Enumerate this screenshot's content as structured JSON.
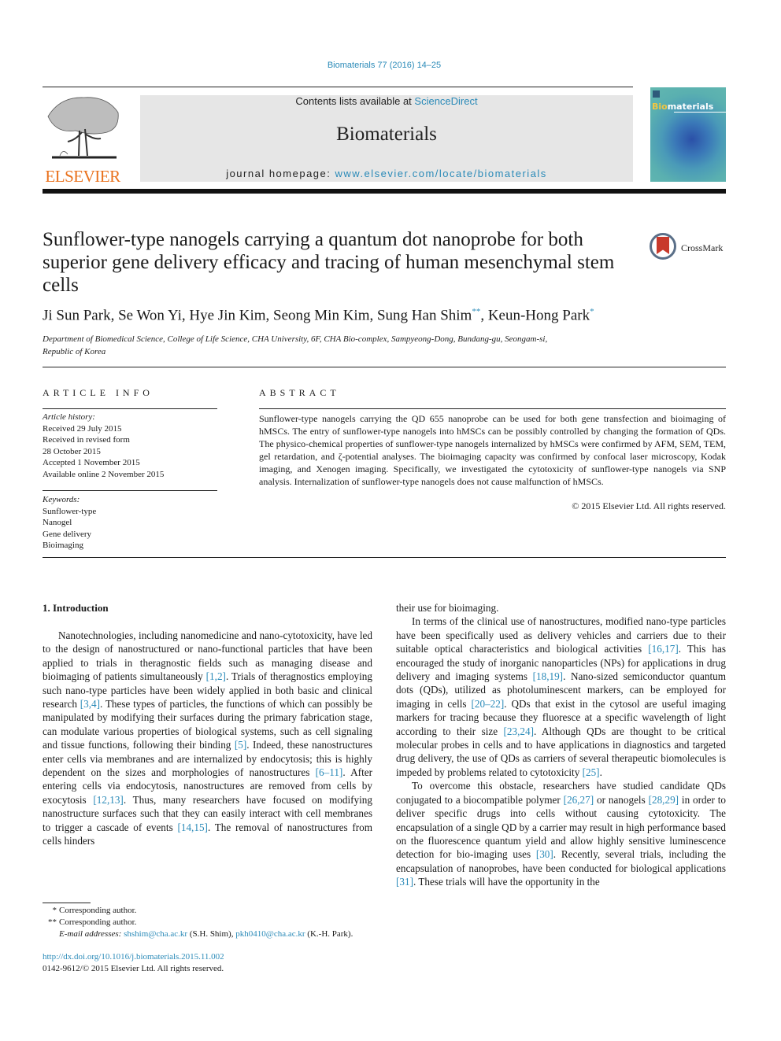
{
  "header": {
    "journal_ref": "Biomaterials 77 (2016) 14–25",
    "contents_prefix": "Contents lists available at ",
    "contents_link": "ScienceDirect",
    "journal_name": "Biomaterials",
    "homepage_prefix": "journal homepage: ",
    "homepage_link": "www.elsevier.com/locate/biomaterials",
    "publisher_logo_text": "ELSEVIER",
    "cover_title_bio": "Bio",
    "cover_title_rest": "materials",
    "accent_color": "#2a8ab8",
    "publisher_color": "#e9711c"
  },
  "article": {
    "title": "Sunflower-type nanogels carrying a quantum dot nanoprobe for both superior gene delivery efficacy and tracing of human mesenchymal stem cells",
    "crossmark_label": "CrossMark",
    "authors": [
      {
        "name": "Ji Sun Park",
        "mark": ""
      },
      {
        "name": "Se Won Yi",
        "mark": ""
      },
      {
        "name": "Hye Jin Kim",
        "mark": ""
      },
      {
        "name": "Seong Min Kim",
        "mark": ""
      },
      {
        "name": "Sung Han Shim",
        "mark": "**"
      },
      {
        "name": "Keun-Hong Park",
        "mark": "*"
      }
    ],
    "affiliation_line1": "Department of Biomedical Science, College of Life Science, CHA University, 6F, CHA Bio-complex, Sampyeong-Dong, Bundang-gu, Seongam-si,",
    "affiliation_line2": "Republic of Korea"
  },
  "article_info": {
    "heading": "ARTICLE INFO",
    "history_label": "Article history:",
    "history": [
      "Received 29 July 2015",
      "Received in revised form",
      "28 October 2015",
      "Accepted 1 November 2015",
      "Available online 2 November 2015"
    ],
    "keywords_label": "Keywords:",
    "keywords": [
      "Sunflower-type",
      "Nanogel",
      "Gene delivery",
      "Bioimaging"
    ]
  },
  "abstract": {
    "heading": "ABSTRACT",
    "text": "Sunflower-type nanogels carrying the QD 655 nanoprobe can be used for both gene transfection and bioimaging of hMSCs. The entry of sunflower-type nanogels into hMSCs can be possibly controlled by changing the formation of QDs. The physico-chemical properties of sunflower-type nanogels internalized by hMSCs were confirmed by AFM, SEM, TEM, gel retardation, and ζ-potential analyses. The bioimaging capacity was confirmed by confocal laser microscopy, Kodak imaging, and Xenogen imaging. Specifically, we investigated the cytotoxicity of sunflower-type nanogels via SNP analysis. Internalization of sunflower-type nanogels does not cause malfunction of hMSCs.",
    "copyright": "© 2015 Elsevier Ltd. All rights reserved."
  },
  "body": {
    "section_heading": "1.  Introduction",
    "left_paragraphs": [
      [
        {
          "t": "Nanotechnologies, including nanomedicine and nano-cytotoxicity, have led to the design of nanostructured or nano-functional particles that have been applied to trials in theragnostic fields such as managing disease and bioimaging of patients simultaneously "
        },
        {
          "ref": "[1,2]"
        },
        {
          "t": ". Trials of theragnostics employing such nano-type particles have been widely applied in both basic and clinical research "
        },
        {
          "ref": "[3,4]"
        },
        {
          "t": ". These types of particles, the functions of which can possibly be manipulated by modifying their surfaces during the primary fabrication stage, can modulate various properties of biological systems, such as cell signaling and tissue functions, following their binding "
        },
        {
          "ref": "[5]"
        },
        {
          "t": ". Indeed, these nanostructures enter cells via membranes and are internalized by endocytosis; this is highly dependent on the sizes and morphologies of nanostructures "
        },
        {
          "ref": "[6–11]"
        },
        {
          "t": ". After entering cells via endocytosis, nanostructures are removed from cells by exocytosis "
        },
        {
          "ref": "[12,13]"
        },
        {
          "t": ". Thus, many researchers have focused on modifying nanostructure surfaces such that they can easily interact with cell membranes to trigger a cascade of events "
        },
        {
          "ref": "[14,15]"
        },
        {
          "t": ". The removal of nanostructures from cells hinders"
        }
      ]
    ],
    "right_paragraphs": [
      [
        {
          "t": "their use for bioimaging."
        }
      ],
      [
        {
          "t": "In terms of the clinical use of nanostructures, modified nano-type particles have been specifically used as delivery vehicles and carriers due to their suitable optical characteristics and biological activities "
        },
        {
          "ref": "[16,17]"
        },
        {
          "t": ". This has encouraged the study of inorganic nanoparticles (NPs) for applications in drug delivery and imaging systems "
        },
        {
          "ref": "[18,19]"
        },
        {
          "t": ". Nano-sized semiconductor quantum dots (QDs), utilized as photoluminescent markers, can be employed for imaging in cells "
        },
        {
          "ref": "[20–22]"
        },
        {
          "t": ". QDs that exist in the cytosol are useful imaging markers for tracing because they fluoresce at a specific wavelength of light according to their size "
        },
        {
          "ref": "[23,24]"
        },
        {
          "t": ". Although QDs are thought to be critical molecular probes in cells and to have applications in diagnostics and targeted drug delivery, the use of QDs as carriers of several therapeutic biomolecules is impeded by problems related to cytotoxicity "
        },
        {
          "ref": "[25]"
        },
        {
          "t": "."
        }
      ],
      [
        {
          "t": "To overcome this obstacle, researchers have studied candidate QDs conjugated to a biocompatible polymer "
        },
        {
          "ref": "[26,27]"
        },
        {
          "t": " or nanogels "
        },
        {
          "ref": "[28,29]"
        },
        {
          "t": " in order to deliver specific drugs into cells without causing cytotoxicity. The encapsulation of a single QD by a carrier may result in high performance based on the fluorescence quantum yield and allow highly sensitive luminescence detection for bio-imaging uses "
        },
        {
          "ref": "[30]"
        },
        {
          "t": ". Recently, several trials, including the encapsulation of nanoprobes, have been conducted for biological applications "
        },
        {
          "ref": "[31]"
        },
        {
          "t": ". These trials will have the opportunity in the"
        }
      ]
    ]
  },
  "footnotes": {
    "note1_mark": "*",
    "note1_text": "Corresponding author.",
    "note2_mark": "**",
    "note2_text": "Corresponding author.",
    "email_label": "E-mail addresses:",
    "email1": "shshim@cha.ac.kr",
    "email1_owner": " (S.H. Shim), ",
    "email2": "pkh0410@cha.ac.kr",
    "email2_owner": " (K.-H. Park).",
    "doi": "http://dx.doi.org/10.1016/j.biomaterials.2015.11.002",
    "issn": "0142-9612/© 2015 Elsevier Ltd. All rights reserved."
  }
}
